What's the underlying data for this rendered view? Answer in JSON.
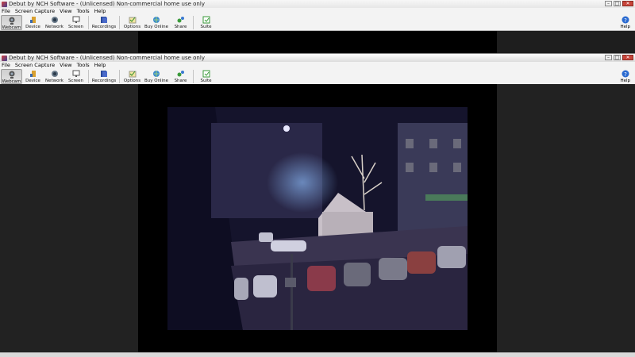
{
  "window": {
    "title": "Debut by NCH Software - (Unlicensed) Non-commercial home use only"
  },
  "menu": [
    "File",
    "Screen Capture",
    "View",
    "Tools",
    "Help"
  ],
  "toolbar": {
    "webcam": "Webcam",
    "device": "Device",
    "network": "Network",
    "screen": "Screen",
    "recordings": "Recordings",
    "options": "Options",
    "buy_online": "Buy Online",
    "share": "Share",
    "suite": "Suite",
    "help": "Help"
  },
  "icons": {
    "webcam": "webcam-icon",
    "device": "device-icon",
    "network": "network-icon",
    "screen": "screen-icon",
    "recordings": "recordings-icon",
    "options": "options-icon",
    "buy_online": "globe-cart-icon",
    "share": "share-icon",
    "suite": "suite-icon",
    "help": "help-icon"
  },
  "colors": {
    "toolbar_bg": "#f3f3f3",
    "preview_bg": "#000000",
    "side_bg": "#222222",
    "close": "#c8443a"
  }
}
